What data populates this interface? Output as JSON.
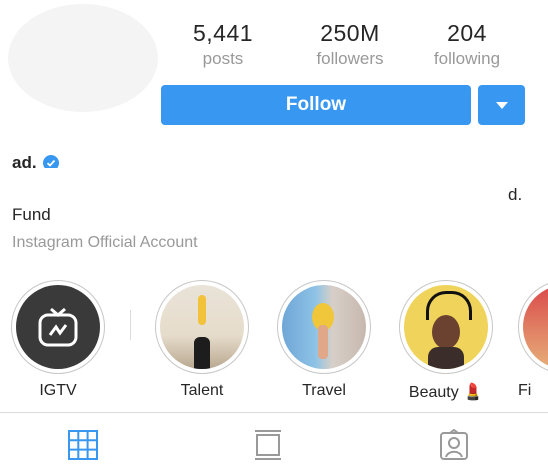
{
  "profile": {
    "stats": [
      {
        "value": "5,441",
        "label": "posts"
      },
      {
        "value": "250M",
        "label": "followers"
      },
      {
        "value": "204",
        "label": "following"
      }
    ],
    "follow_label": "Follow",
    "name_fragment": "ad.",
    "bio_fragment_left": "Fund",
    "bio_fragment_right": "d.",
    "subtitle": "Instagram Official Account"
  },
  "highlights": [
    {
      "label": "IGTV",
      "icon": "igtv-icon"
    },
    {
      "label": "Talent",
      "icon": "talent-photo"
    },
    {
      "label": "Travel",
      "icon": "travel-photo"
    },
    {
      "label": "Beauty 💄",
      "icon": "beauty-photo"
    },
    {
      "label": "Fi",
      "icon": "partial-photo"
    }
  ],
  "colors": {
    "accent": "#3897f0",
    "muted": "#999999",
    "text": "#262626"
  },
  "tabs": [
    "grid-icon",
    "feed-icon",
    "tagged-icon"
  ]
}
